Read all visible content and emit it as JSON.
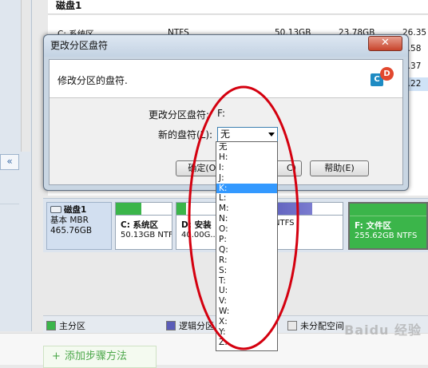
{
  "background": {
    "disk_header": "磁盘1",
    "partitions": [
      {
        "name": "C: 系统区",
        "fs": "NTFS",
        "size": "50.13GB",
        "used": "23.78GB",
        "free": "26.35"
      },
      {
        "name": "",
        "fs": "",
        "size": "",
        "used": "",
        "free": "4.58"
      },
      {
        "name": "",
        "fs": "",
        "size": "",
        "used": "",
        "free": "3.37"
      },
      {
        "name": "",
        "fs": "",
        "size": "",
        "used": "",
        "free": "4.22"
      }
    ],
    "collapse_glyph": "«"
  },
  "disk_map": {
    "disk": {
      "name": "磁盘1",
      "type": "基本 MBR",
      "size": "465.76GB"
    },
    "blocks": [
      {
        "label": "C: 系统区",
        "size": "50.13GB NTFS",
        "fill_pct": 45
      },
      {
        "label": "D: 安装",
        "size": "40.00G..."
      },
      {
        "label": "",
        "size": "NTFS"
      },
      {
        "label": "F: 文件区",
        "size": "255.62GB NTFS"
      }
    ]
  },
  "legend": {
    "primary": "主分区",
    "logical": "逻辑分区",
    "unallocated": "未分配空间"
  },
  "dialog": {
    "title": "更改分区盘符",
    "close_glyph": "✕",
    "message": "修改分区的盘符.",
    "icon_c": "C",
    "icon_d": "D",
    "current_label": "更改分区盘符:",
    "current_value": "F:",
    "new_label": "新的盘符(L):",
    "new_value": "无",
    "ok_button": "确定(O)",
    "cancel_button_visible": "C)",
    "help_button": "帮助(E)"
  },
  "dropdown": {
    "options": [
      "无",
      "H:",
      "I:",
      "J:",
      "K:",
      "L:",
      "M:",
      "N:",
      "O:",
      "P:",
      "Q:",
      "R:",
      "S:",
      "T:",
      "U:",
      "V:",
      "W:",
      "X:",
      "Y:",
      "Z:"
    ],
    "highlighted": "K:"
  },
  "footer": {
    "add_step": "添加步骤方法",
    "watermark": "Baidu 经验"
  },
  "colors": {
    "primary_green": "#3bb54a",
    "logical_blue": "#5a5cb8",
    "highlight": "#3399ff",
    "annotation_red": "#d4000f"
  }
}
